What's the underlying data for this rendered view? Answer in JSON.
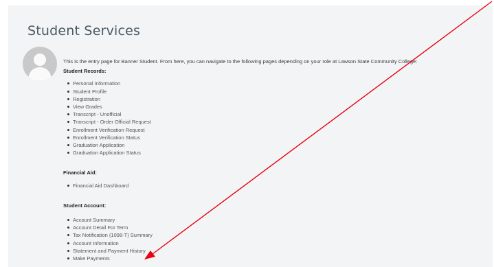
{
  "page": {
    "title": "Student Services",
    "intro": "This is the entry page for Banner Student. From here, you can navigate to the following pages depending on your role at Lawson State Community College:"
  },
  "sections": {
    "records": {
      "heading": "Student Records:",
      "items": [
        "Personal Information",
        "Student Profile",
        "Registration",
        "View Grades",
        "Transcript - Unofficial",
        "Transcript - Order Official Request",
        "Enrollment Verification Request",
        "Enrollment Verification Status",
        "Graduation Application",
        "Graduation Application Status"
      ]
    },
    "aid": {
      "heading": "Financial Aid:",
      "items": [
        "Financial Aid Dashboard"
      ]
    },
    "account": {
      "heading": "Student Account:",
      "items": [
        "Account Summary",
        "Account Detail For Term",
        "Tax Notification (1098-T) Summary",
        "Account Information",
        "Statement and Payment History",
        "Make Payments"
      ]
    }
  },
  "colors": {
    "annotation_arrow": "#e8000f",
    "title": "#4a5a66",
    "panel_background": "#f3f4f6"
  },
  "icons": [
    "avatar-silhouette-icon"
  ]
}
